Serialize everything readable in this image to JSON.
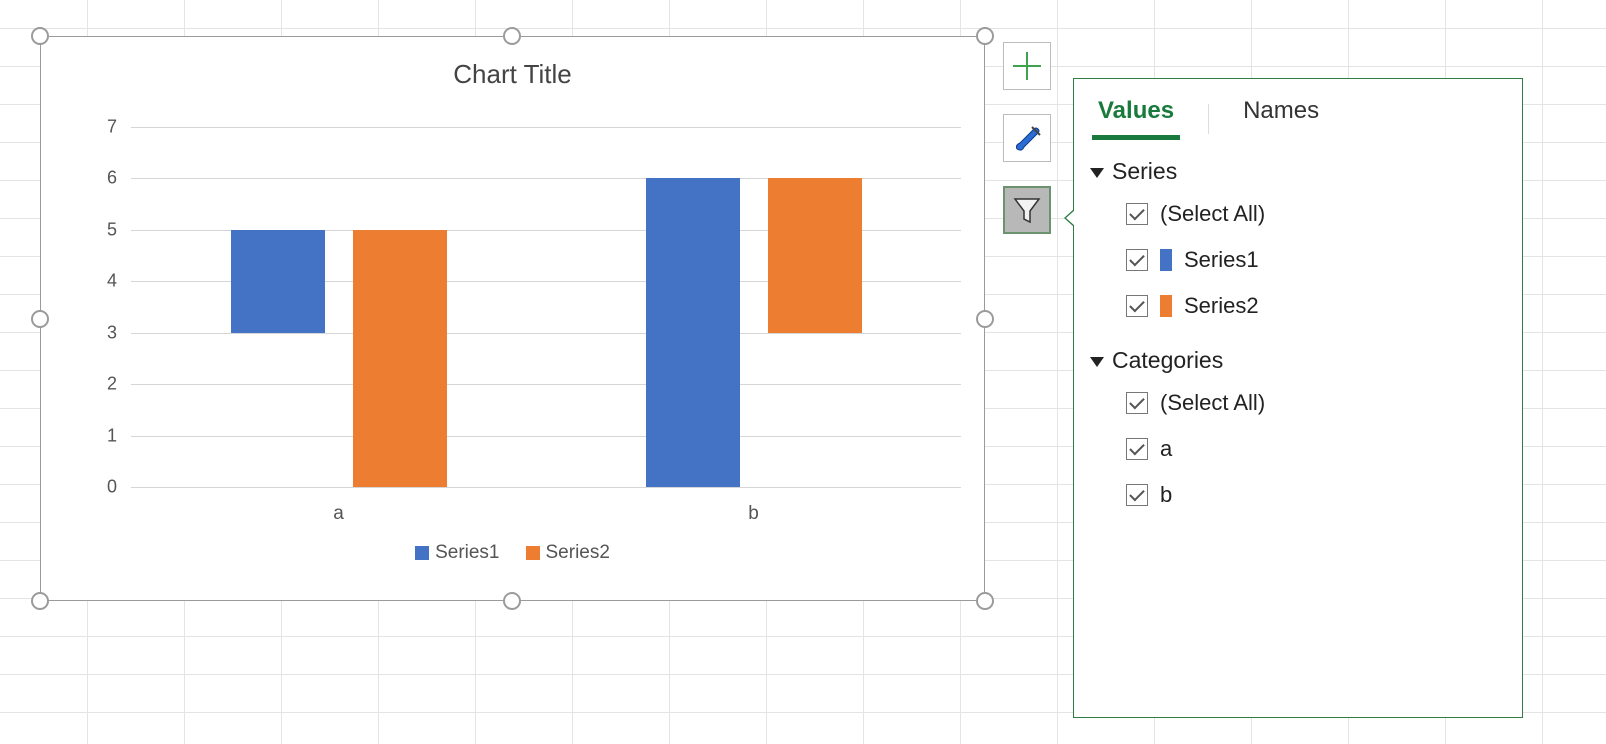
{
  "chart_data": {
    "type": "bar",
    "title": "Chart Title",
    "categories": [
      "a",
      "b"
    ],
    "series": [
      {
        "name": "Series1",
        "values": [
          2,
          6
        ],
        "color": "#4472c4"
      },
      {
        "name": "Series2",
        "values": [
          5,
          3
        ],
        "color": "#ed7d31"
      }
    ],
    "xlabel": "",
    "ylabel": "",
    "ylim": [
      0,
      7
    ],
    "yticks": [
      0,
      1,
      2,
      3,
      4,
      5,
      6,
      7
    ],
    "grid": true,
    "legend_position": "bottom"
  },
  "filter_panel": {
    "tabs": {
      "values": "Values",
      "names": "Names",
      "active": "values"
    },
    "series_group": {
      "label": "Series",
      "select_all": "(Select All)",
      "items": [
        {
          "label": "Series1",
          "color": "#4472c4",
          "checked": true
        },
        {
          "label": "Series2",
          "color": "#ed7d31",
          "checked": true
        }
      ]
    },
    "categories_group": {
      "label": "Categories",
      "select_all": "(Select All)",
      "items": [
        {
          "label": "a",
          "checked": true
        },
        {
          "label": "b",
          "checked": true
        }
      ]
    }
  },
  "side_tools": {
    "add": "chart-elements",
    "style": "chart-styles",
    "filter": "chart-filters"
  }
}
